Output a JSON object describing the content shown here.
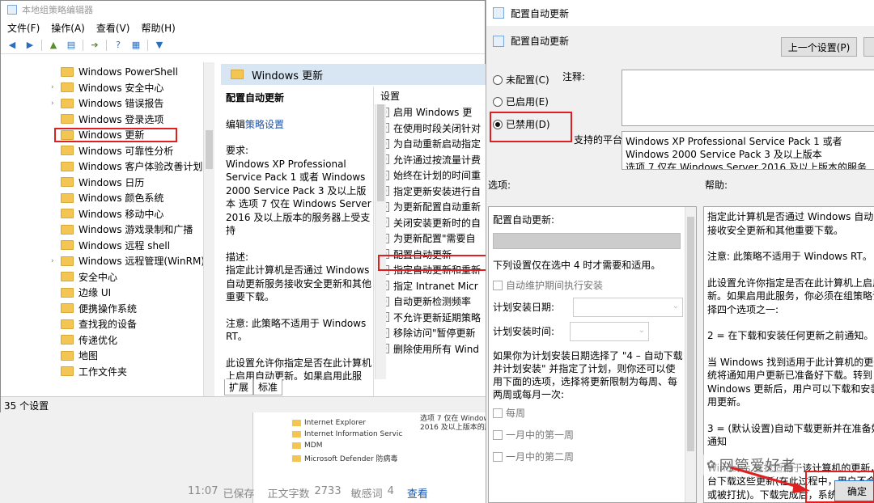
{
  "gp_window": {
    "title": "本地组策略编辑器",
    "menu": [
      "文件(F)",
      "操作(A)",
      "查看(V)",
      "帮助(H)"
    ],
    "tree_items": [
      {
        "label": "Windows PowerShell",
        "expandable": false
      },
      {
        "label": "Windows 安全中心",
        "expandable": true
      },
      {
        "label": "Windows 错误报告",
        "expandable": true
      },
      {
        "label": "Windows 登录选项",
        "expandable": false
      },
      {
        "label": "Windows 更新",
        "expandable": false,
        "selected": true
      },
      {
        "label": "Windows 可靠性分析",
        "expandable": false
      },
      {
        "label": "Windows 客户体验改善计划",
        "expandable": false
      },
      {
        "label": "Windows 日历",
        "expandable": false
      },
      {
        "label": "Windows 颜色系统",
        "expandable": false
      },
      {
        "label": "Windows 移动中心",
        "expandable": false
      },
      {
        "label": "Windows 游戏录制和广播",
        "expandable": false
      },
      {
        "label": "Windows 远程 shell",
        "expandable": false
      },
      {
        "label": "Windows 远程管理(WinRM)",
        "expandable": true
      },
      {
        "label": "安全中心",
        "expandable": false
      },
      {
        "label": "边缘 UI",
        "expandable": false
      },
      {
        "label": "便携操作系统",
        "expandable": false
      },
      {
        "label": "查找我的设备",
        "expandable": false
      },
      {
        "label": "传递优化",
        "expandable": false
      },
      {
        "label": "地图",
        "expandable": false
      },
      {
        "label": "工作文件夹",
        "expandable": false
      }
    ],
    "mid_header": "Windows 更新",
    "desc_title": "配置自动更新",
    "desc_edit_prefix": "编辑",
    "desc_edit_link": "策略设置",
    "desc_req_label": "要求:",
    "desc_req_text": "Windows XP Professional Service Pack 1 或者 Windows 2000 Service Pack 3 及以上版本 选项 7 仅在 Windows Server 2016 及以上版本的服务器上受支持",
    "desc_desc_label": "描述:",
    "desc_desc_text": "指定此计算机是否通过 Windows 自动更新服务接收安全更新和其他重要下载。",
    "desc_note": "注意: 此策略不适用于 Windows RT。",
    "desc_more": "此设置允许你指定是否在此计算机上启用自动更新。如果启用此服",
    "settings_header": "设置",
    "settings": [
      "启用 Windows 更",
      "在使用时段关闭针对",
      "为自动重新启动指定",
      "允许通过按流量计费",
      "始终在计划的时间重",
      "指定更新安装进行自",
      "为更新配置自动重新",
      "关闭安装更新时的自",
      "为更新配置\"需要自",
      "配置自动更新",
      "指定自动更新和重新",
      "指定 Intranet Micr",
      "自动更新检测频率",
      "不允许更新延期策略",
      "移除访问\"暂停更新",
      "删除使用所有 Wind"
    ],
    "tabs": [
      "扩展",
      "标准"
    ],
    "status": "35 个设置"
  },
  "background_doc": {
    "lines": [
      "选项 7 仅在 Windows Se",
      "2016 及以上版本的服务器上"
    ],
    "tree": [
      "Internet Explorer",
      "Internet Information Servic",
      "MDM",
      "Microsoft Defender 防病毒"
    ],
    "status_time": "11:07",
    "status_saved": "已保存",
    "status_words_label": "正文字数",
    "status_words": "2733",
    "status_sensitive_label": "敏感词",
    "status_sensitive_count": "4",
    "status_view": "查看",
    "watermark": "网管爱好者"
  },
  "dialog": {
    "title": "配置自动更新",
    "subtitle": "配置自动更新",
    "prev_button": "上一个设置(P)",
    "radio_not_configured": "未配置(C)",
    "radio_enabled": "已启用(E)",
    "radio_disabled": "已禁用(D)",
    "comment_label": "注释:",
    "platform_label": "支持的平台:",
    "platform_text": "Windows XP Professional Service Pack 1 或者 Windows 2000 Service Pack 3 及以上版本",
    "platform_text2": "选项 7 仅在 Windows Server 2016 及以上版本的服务器上受支持",
    "options_label": "选项:",
    "help_label": "帮助:",
    "opt_title": "配置自动更新:",
    "opt_note": "下列设置仅在选中 4 时才需要和适用。",
    "opt_maint": "自动维护期间执行安装",
    "opt_day_label": "计划安装日期:",
    "opt_time_label": "计划安装时间:",
    "opt_paragraph": "如果你为计划安装日期选择了 \"4 – 自动下载并计划安装\" 并指定了计划，则你还可以使用下面的选项，选择将更新限制为每周、每两周或每月一次:",
    "opt_weekly": "每周",
    "opt_first_week": "一月中的第一周",
    "opt_second_week": "一月中的第二周",
    "help_p1": "指定此计算机是否通过 Windows 自动更新服务接收安全更新和其他重要下载。",
    "help_p2": "注意: 此策略不适用于 Windows RT。",
    "help_p3": "此设置允许你指定是否在此计算机上启用自动更新。如果启用此服务，你必须在组策略设置中选择四个选项之一:",
    "help_p4": "2 = 在下载和安装任何更新之前通知。",
    "help_p5": "当 Windows 找到适用于此计算机的更新时，系统将通知用户更新已准备好下载。转到 Windows 更新后，用户可以下载和安装任何可用更新。",
    "help_p6": "3 = (默认设置)自动下载更新并在准备好安装时通知",
    "help_p7": "Windows 查找适用于该计算机的更新，并在后台下载这些更新(在此过程中，用户不会收到通知或被打扰)。下载完成后，系统将通知用户它们已准备好安装。转到 Windows 更新后，用户即可安装它们。",
    "ok_button": "确定"
  },
  "colors": {
    "highlight_red": "#e02020",
    "link_blue": "#1a56b0",
    "folder_yellow": "#f3c553"
  }
}
